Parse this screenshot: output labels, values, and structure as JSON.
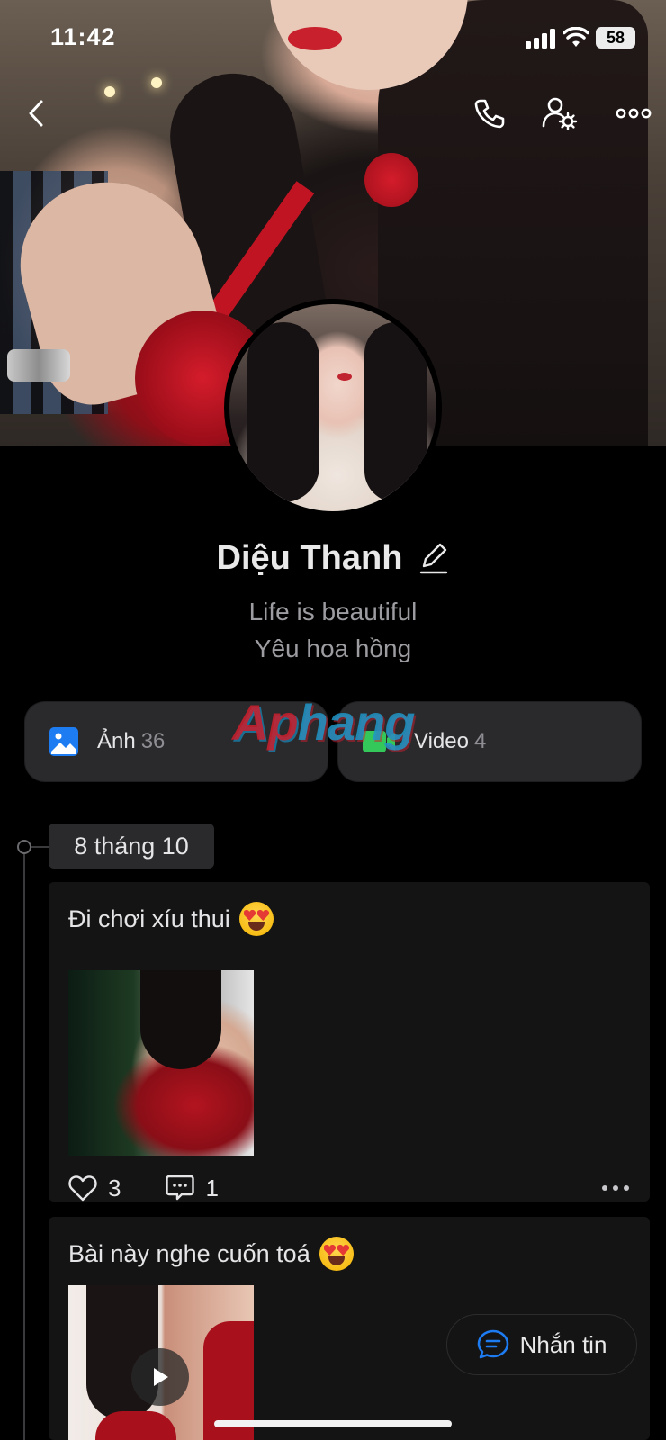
{
  "status_bar": {
    "time": "11:42",
    "battery": "58"
  },
  "profile": {
    "name": "Diệu Thanh",
    "bio_line1": "Life is beautiful",
    "bio_line2": "Yêu hoa hồng"
  },
  "media": [
    {
      "label": "Ảnh",
      "count": "36",
      "icon": "image-icon",
      "color": "#1e7cf2"
    },
    {
      "label": "Video",
      "count": "4",
      "icon": "video-camera-icon",
      "color": "#34c759"
    }
  ],
  "watermark": {
    "part1": "Ap",
    "part2": "hang"
  },
  "timeline": {
    "date_label": "8 tháng 10"
  },
  "posts": [
    {
      "text": "Đi chơi xíu thui",
      "emoji": "heart-eyes-emoji",
      "likes": "3",
      "comments": "1",
      "media_type": "photo"
    },
    {
      "text": "Bài này nghe cuốn toá",
      "emoji": "heart-eyes-emoji",
      "media_type": "video"
    }
  ],
  "message_button": {
    "label": "Nhắn tin"
  },
  "colors": {
    "background": "#000000",
    "card": "#2a2a2d",
    "post_bg": "#141414",
    "accent_blue": "#1e7cf2",
    "accent_green": "#34c759",
    "muted_text": "#9c9ca1"
  }
}
